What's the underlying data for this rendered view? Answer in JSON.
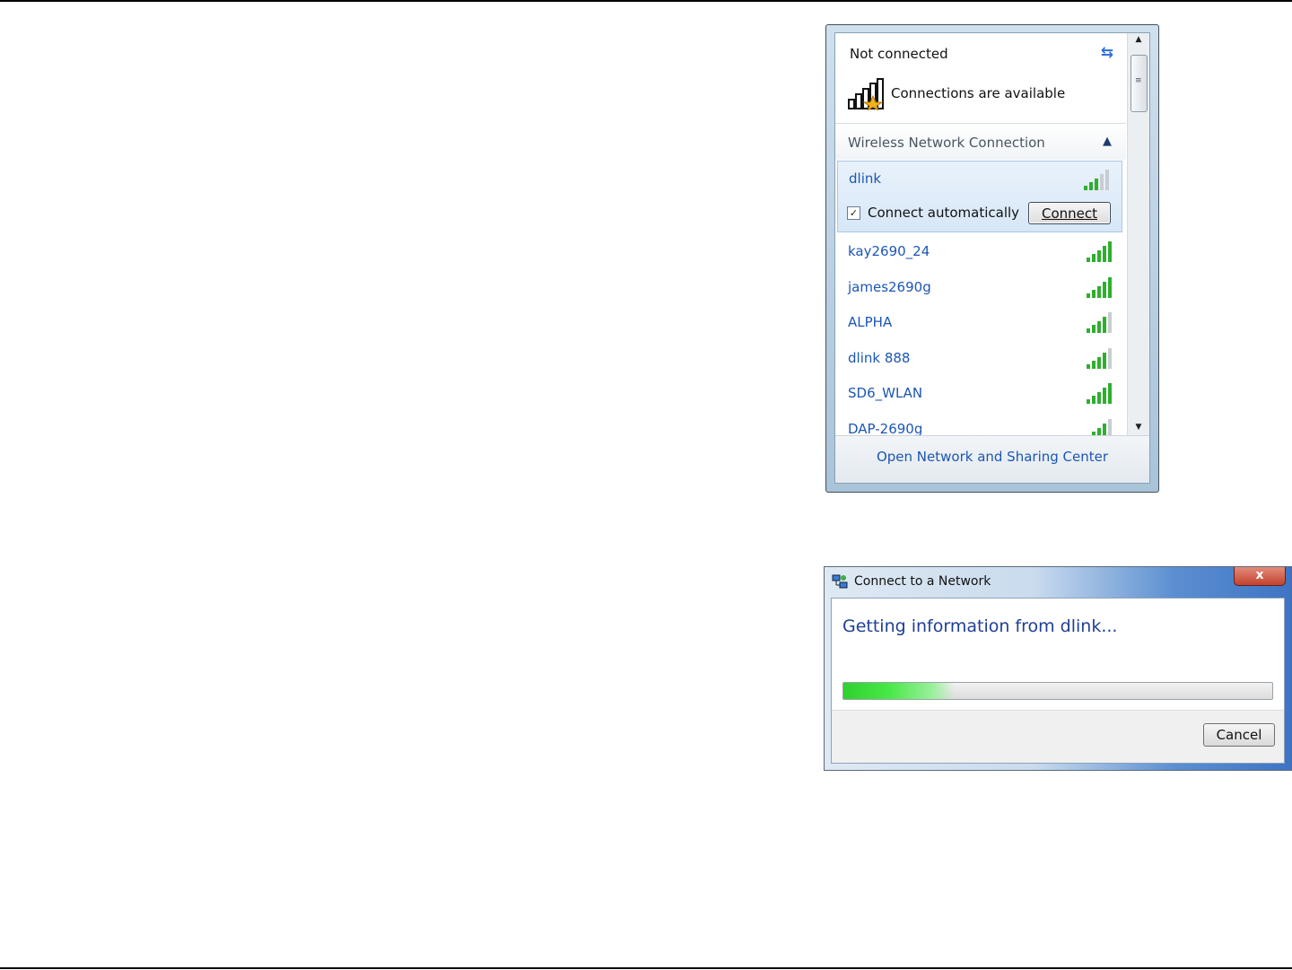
{
  "flyout": {
    "status_title": "Not connected",
    "availability_text": "Connections are available",
    "section_label": "Wireless Network Connection",
    "selected_network": {
      "name": "dlink",
      "signal_bars": 3,
      "connect_auto_label": "Connect automatically",
      "connect_auto_checked": true,
      "checkbox_mark": "✓",
      "connect_button_label": "Connect"
    },
    "networks": [
      {
        "name": "kay2690_24",
        "signal_bars": 5
      },
      {
        "name": "james2690g",
        "signal_bars": 5
      },
      {
        "name": "ALPHA",
        "signal_bars": 4
      },
      {
        "name": "dlink 888",
        "signal_bars": 4
      },
      {
        "name": "SD6_WLAN",
        "signal_bars": 5
      },
      {
        "name": "DAP-2690g",
        "signal_bars": 4
      }
    ],
    "footer_link": "Open Network and Sharing Center"
  },
  "dialog": {
    "title": "Connect to a Network",
    "heading": "Getting information from dlink...",
    "progress": 0.26,
    "cancel_label": "Cancel",
    "close_glyph": "x"
  },
  "colors": {
    "link": "#1c56b5",
    "signal_on": "#2fae2f",
    "signal_off": "#c8cdd2"
  }
}
